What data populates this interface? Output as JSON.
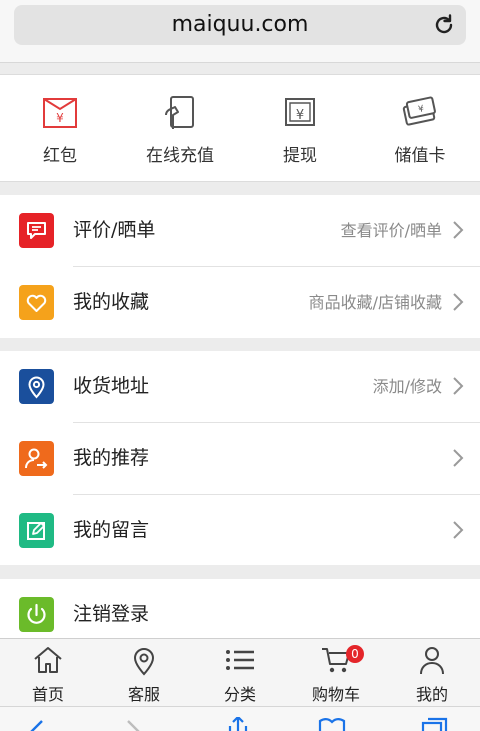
{
  "browser": {
    "url": "maiquu.com"
  },
  "wallet": [
    {
      "label": "红包",
      "icon": "red-envelope-icon"
    },
    {
      "label": "在线充值",
      "icon": "online-recharge-icon"
    },
    {
      "label": "提现",
      "icon": "withdraw-icon"
    },
    {
      "label": "储值卡",
      "icon": "stored-value-card-icon"
    }
  ],
  "menu": {
    "group1": [
      {
        "title": "评价/晒单",
        "hint": "查看评价/晒单",
        "icon": "review-icon",
        "color": "#e62227"
      },
      {
        "title": "我的收藏",
        "hint": "商品收藏/店铺收藏",
        "icon": "heart-icon",
        "color": "#f5a21b"
      }
    ],
    "group2": [
      {
        "title": "收货地址",
        "hint": "添加/修改",
        "icon": "location-icon",
        "color": "#1a4f9c"
      },
      {
        "title": "我的推荐",
        "hint": "",
        "icon": "recommend-icon",
        "color": "#ef6a1c"
      },
      {
        "title": "我的留言",
        "hint": "",
        "icon": "message-icon",
        "color": "#1fba84"
      }
    ],
    "group3": [
      {
        "title": "注销登录",
        "hint": "",
        "icon": "power-icon",
        "color": "#6bbb2a"
      }
    ]
  },
  "tabbar": [
    {
      "label": "首页",
      "icon": "home-icon"
    },
    {
      "label": "客服",
      "icon": "customer-service-icon"
    },
    {
      "label": "分类",
      "icon": "category-list-icon"
    },
    {
      "label": "购物车",
      "icon": "cart-icon",
      "badge": "0"
    },
    {
      "label": "我的",
      "icon": "profile-icon"
    }
  ],
  "colors": {
    "accent_red": "#e4252a",
    "wallet_icon_red": "#e23b3b",
    "wallet_icon_gray": "#555555"
  }
}
